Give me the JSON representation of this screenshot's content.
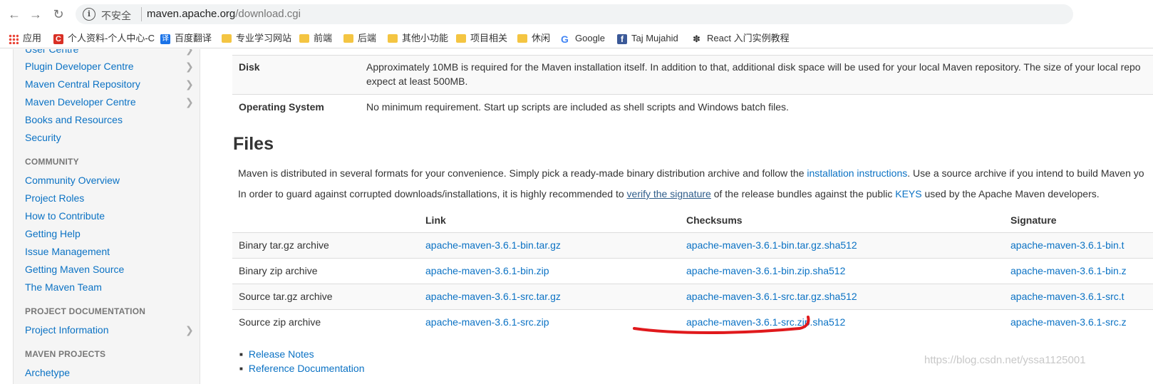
{
  "browser": {
    "insecure_label": "不安全",
    "url_host": "maven.apache.org",
    "url_path": "/download.cgi",
    "bookmarks": [
      {
        "label": "应用",
        "icon": "apps-grid-icon"
      },
      {
        "label": "个人资料-个人中心-C",
        "icon": "csdn-icon"
      },
      {
        "label": "百度翻译",
        "icon": "translate-icon"
      },
      {
        "label": "专业学习网站",
        "icon": "folder-icon"
      },
      {
        "label": "前端",
        "icon": "folder-icon"
      },
      {
        "label": "后端",
        "icon": "folder-icon"
      },
      {
        "label": "其他小功能",
        "icon": "folder-icon"
      },
      {
        "label": "项目相关",
        "icon": "folder-icon"
      },
      {
        "label": "休闲",
        "icon": "folder-icon"
      },
      {
        "label": "Google",
        "icon": "google-icon"
      },
      {
        "label": "Taj Mujahid",
        "icon": "facebook-icon"
      },
      {
        "label": "React 入门实例教程",
        "icon": "react-icon"
      }
    ]
  },
  "sidebar": {
    "items_top": [
      {
        "label": "User Centre",
        "chevron": true
      },
      {
        "label": "Plugin Developer Centre",
        "chevron": true
      },
      {
        "label": "Maven Central Repository",
        "chevron": true
      },
      {
        "label": "Maven Developer Centre",
        "chevron": true
      },
      {
        "label": "Books and Resources",
        "chevron": false
      },
      {
        "label": "Security",
        "chevron": false
      }
    ],
    "community_heading": "COMMUNITY",
    "community_items": [
      "Community Overview",
      "Project Roles",
      "How to Contribute",
      "Getting Help",
      "Issue Management",
      "Getting Maven Source",
      "The Maven Team"
    ],
    "project_doc_heading": "PROJECT DOCUMENTATION",
    "project_doc_items": [
      "Project Information"
    ],
    "maven_projects_heading": "MAVEN PROJECTS",
    "maven_projects_items": [
      "Archetype"
    ]
  },
  "requirements": {
    "disk_label": "Disk",
    "disk_line1": "Approximately 10MB is required for the Maven installation itself. In addition to that, additional disk space will be used for your local Maven repository. The size of your local repo",
    "disk_line2": "expect at least 500MB.",
    "os_label": "Operating System",
    "os_value": "No minimum requirement. Start up scripts are included as shell scripts and Windows batch files."
  },
  "files": {
    "heading": "Files",
    "para1_a": "Maven is distributed in several formats for your convenience. Simply pick a ready-made binary distribution archive and follow the ",
    "para1_link": "installation instructions",
    "para1_b": ". Use a source archive if you intend to build Maven yo",
    "para2_a": "In order to guard against corrupted downloads/installations, it is highly recommended to ",
    "para2_link": "verify the signature",
    "para2_b": " of the release bundles against the public ",
    "para2_keys": "KEYS",
    "para2_c": " used by the Apache Maven developers.",
    "headers": {
      "link": "Link",
      "checksums": "Checksums",
      "signature": "Signature"
    },
    "rows": [
      {
        "label": "Binary tar.gz archive",
        "link": "apache-maven-3.6.1-bin.tar.gz",
        "checksum": "apache-maven-3.6.1-bin.tar.gz.sha512",
        "signature": "apache-maven-3.6.1-bin.t"
      },
      {
        "label": "Binary zip archive",
        "link": "apache-maven-3.6.1-bin.zip",
        "checksum": "apache-maven-3.6.1-bin.zip.sha512",
        "signature": "apache-maven-3.6.1-bin.z"
      },
      {
        "label": "Source tar.gz archive",
        "link": "apache-maven-3.6.1-src.tar.gz",
        "checksum": "apache-maven-3.6.1-src.tar.gz.sha512",
        "signature": "apache-maven-3.6.1-src.t"
      },
      {
        "label": "Source zip archive",
        "link": "apache-maven-3.6.1-src.zip",
        "checksum": "apache-maven-3.6.1-src.zip.sha512",
        "signature": "apache-maven-3.6.1-src.z"
      }
    ],
    "bullets": [
      "Release Notes",
      "Reference Documentation"
    ]
  },
  "watermark": "https://blog.csdn.net/yssa1125001",
  "colors": {
    "link": "#0b72c4",
    "annotation_red": "#e0191c"
  }
}
